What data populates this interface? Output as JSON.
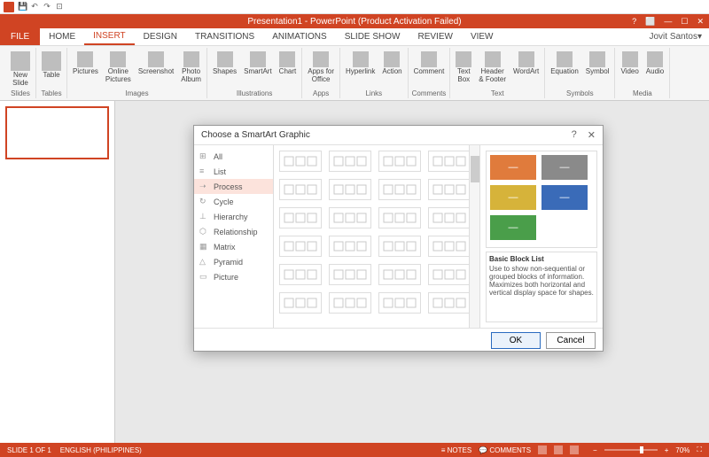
{
  "title": "Presentation1 - PowerPoint (Product Activation Failed)",
  "user": "Jovit Santos",
  "tabs": {
    "file": "FILE",
    "home": "HOME",
    "insert": "INSERT",
    "design": "DESIGN",
    "transitions": "TRANSITIONS",
    "animations": "ANIMATIONS",
    "slideshow": "SLIDE SHOW",
    "review": "REVIEW",
    "view": "VIEW"
  },
  "ribbon": {
    "slides": {
      "new": "New\nSlide",
      "lbl": "Slides"
    },
    "tables": {
      "table": "Table",
      "lbl": "Tables"
    },
    "images": {
      "pictures": "Pictures",
      "online": "Online\nPictures",
      "screenshot": "Screenshot",
      "album": "Photo\nAlbum",
      "lbl": "Images"
    },
    "illus": {
      "shapes": "Shapes",
      "smartart": "SmartArt",
      "chart": "Chart",
      "lbl": "Illustrations"
    },
    "apps": {
      "office": "Apps for\nOffice",
      "lbl": "Apps"
    },
    "links": {
      "hyperlink": "Hyperlink",
      "action": "Action",
      "lbl": "Links"
    },
    "comments": {
      "comment": "Comment",
      "lbl": "Comments"
    },
    "text": {
      "textbox": "Text\nBox",
      "header": "Header\n& Footer",
      "wordart": "WordArt",
      "lbl": "Text"
    },
    "symbols": {
      "equation": "Equation",
      "symbol": "Symbol",
      "lbl": "Symbols"
    },
    "media": {
      "video": "Video",
      "audio": "Audio",
      "lbl": "Media"
    }
  },
  "status": {
    "slide": "SLIDE 1 OF 1",
    "lang": "ENGLISH (PHILIPPINES)",
    "notes": "NOTES",
    "comments": "COMMENTS",
    "zoom": "70%"
  },
  "dialog": {
    "title": "Choose a SmartArt Graphic",
    "help": "?",
    "close": "✕",
    "cats": [
      {
        "ico": "⊞",
        "label": "All"
      },
      {
        "ico": "≡",
        "label": "List"
      },
      {
        "ico": "➝",
        "label": "Process"
      },
      {
        "ico": "↻",
        "label": "Cycle"
      },
      {
        "ico": "⊥",
        "label": "Hierarchy"
      },
      {
        "ico": "⬡",
        "label": "Relationship"
      },
      {
        "ico": "▦",
        "label": "Matrix"
      },
      {
        "ico": "△",
        "label": "Pyramid"
      },
      {
        "ico": "▭",
        "label": "Picture"
      }
    ],
    "selected_cat": "Process",
    "preview": {
      "blocks": [
        {
          "color": "#e07b3c"
        },
        {
          "color": "#8a8a8a"
        },
        {
          "color": "#d6b33a"
        },
        {
          "color": "#3a6bb8"
        },
        {
          "color": "#4a9e4a"
        }
      ],
      "title": "Basic Block List",
      "desc": "Use to show non-sequential or grouped blocks of information. Maximizes both horizontal and vertical display space for shapes."
    },
    "ok": "OK",
    "cancel": "Cancel"
  }
}
